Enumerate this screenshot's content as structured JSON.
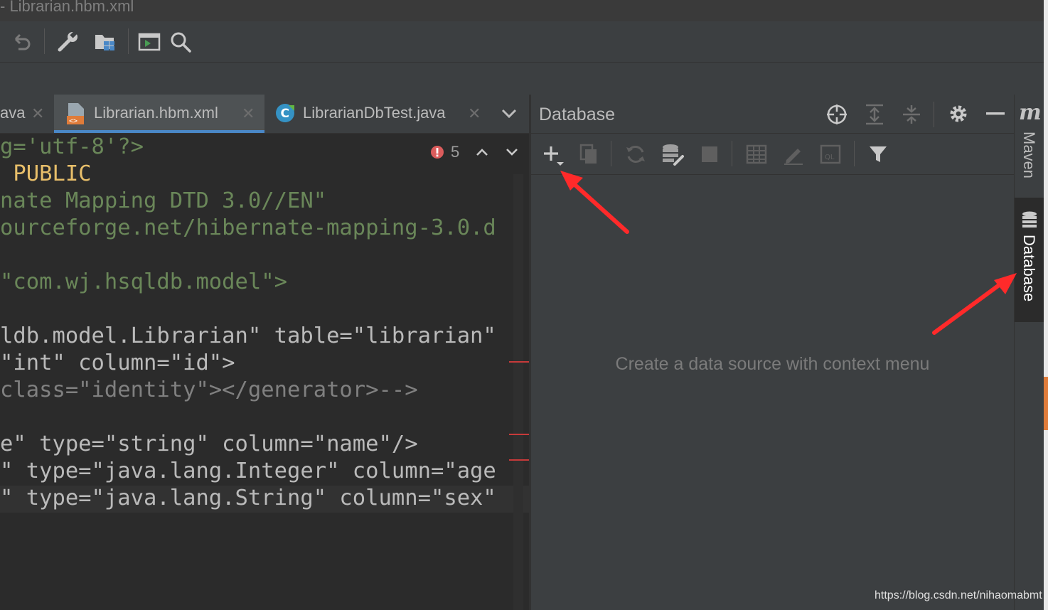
{
  "window": {
    "title": "- Librarian.hbm.xml"
  },
  "toolbar": {
    "icons": [
      "undo-icon",
      "wrench-icon",
      "project-structure-icon",
      "run-console-icon",
      "search-icon"
    ]
  },
  "tabs": [
    {
      "label": "ava",
      "closable": true,
      "active": false
    },
    {
      "label": "Librarian.hbm.xml",
      "closable": true,
      "active": true
    },
    {
      "label": "LibrarianDbTest.java",
      "closable": true,
      "active": false
    }
  ],
  "tab_close_glyph": "✕",
  "tab_more_glyph": "⌄",
  "editor": {
    "inspection_count": "5",
    "lines": [
      "g='utf-8'?>",
      " PUBLIC",
      "nate Mapping DTD 3.0//EN\"",
      "ourceforge.net/hibernate-mapping-3.0.d",
      "",
      "\"com.wj.hsqldb.model\">",
      "",
      "ldb.model.Librarian\" table=\"librarian\"",
      "\"int\" column=\"id\">",
      "class=\"identity\"></generator>-->",
      "",
      "e\" type=\"string\" column=\"name\"/>",
      "\" type=\"java.lang.Integer\" column=\"age",
      "\" type=\"java.lang.String\" column=\"sex\""
    ]
  },
  "database_panel": {
    "title": "Database",
    "header_icons": [
      "locate-icon",
      "expand-all-icon",
      "collapse-all-icon",
      "settings-gear-icon",
      "minimize-icon"
    ],
    "toolbar_icons": [
      "add-datasource-icon",
      "copy-icon",
      "refresh-icon",
      "db-properties-icon",
      "stop-icon",
      "table-view-icon",
      "edit-icon",
      "query-console-icon",
      "filter-icon"
    ],
    "empty_text": "Create a data source with context menu"
  },
  "side_tools": [
    {
      "label": "Maven",
      "icon": "maven-icon",
      "icon_glyph": "m"
    },
    {
      "label": "Database",
      "icon": "database-icon",
      "active": true
    }
  ],
  "watermark": "https://blog.csdn.net/nihaomabmt",
  "colors": {
    "accent": "#4a88c7",
    "annotation_arrow": "#ff2a2a",
    "error": "#c73a3a"
  }
}
